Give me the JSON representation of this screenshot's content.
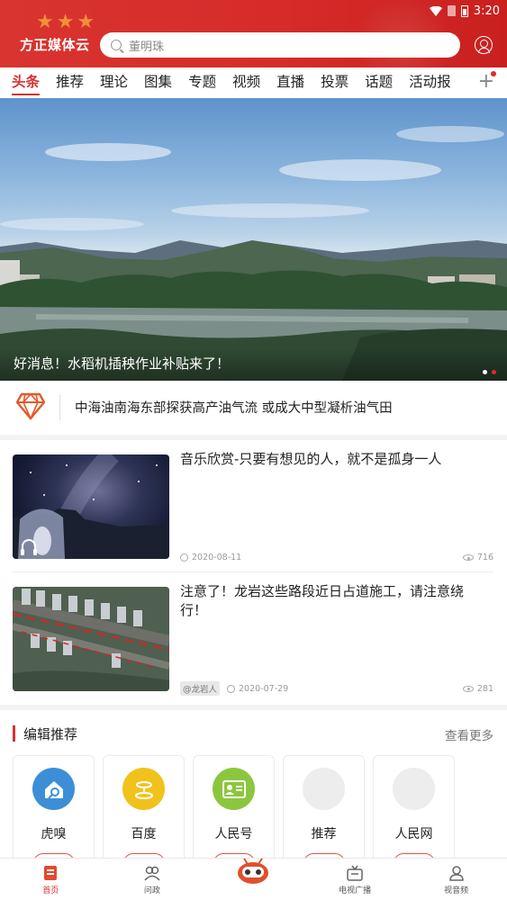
{
  "status_bar": {
    "time": "3:20"
  },
  "header": {
    "app_title": "方正媒体云",
    "search_placeholder": "董明珠",
    "accent_color": "#d63230"
  },
  "tabs": [
    {
      "label": "头条",
      "active": true
    },
    {
      "label": "推荐"
    },
    {
      "label": "理论"
    },
    {
      "label": "图集"
    },
    {
      "label": "专题"
    },
    {
      "label": "视频"
    },
    {
      "label": "直播"
    },
    {
      "label": "投票"
    },
    {
      "label": "话题"
    },
    {
      "label": "活动报"
    }
  ],
  "banner": {
    "caption": "好消息！水稻机插秧作业补贴来了！",
    "slide_count": 2,
    "active_slide": 2
  },
  "headline": {
    "text": "中海油南海东部探获高产油气流 或成大中型凝析油气田"
  },
  "news": [
    {
      "title": "音乐欣赏-只要有想见的人，就不是孤身一人",
      "date": "2020-08-11",
      "views": "716",
      "tag": "",
      "thumb": "night-sky",
      "audio": true
    },
    {
      "title": "注意了！龙岩这些路段近日占道施工，请注意绕行！",
      "date": "2020-07-29",
      "views": "281",
      "tag": "@龙岩人",
      "thumb": "aerial-city",
      "audio": false
    }
  ],
  "editor": {
    "title": "编辑推荐",
    "more": "查看更多",
    "cards": [
      {
        "name": "虎嗅",
        "icon": "huxiu-icon",
        "color": "#3c8fd6"
      },
      {
        "name": "百度",
        "icon": "baidu-icon",
        "color": "#f1c21b"
      },
      {
        "name": "人民号",
        "icon": "renminhao-icon",
        "color": "#8cc63e"
      },
      {
        "name": "推荐",
        "icon": "placeholder-icon",
        "color": "#ededed"
      },
      {
        "name": "人民网",
        "icon": "placeholder-icon",
        "color": "#ededed"
      }
    ]
  },
  "bottom_nav": [
    {
      "label": "首页",
      "icon": "home-icon",
      "active": true
    },
    {
      "label": "问政",
      "icon": "people-icon"
    },
    {
      "label": "",
      "icon": "robot-icon"
    },
    {
      "label": "电视广播",
      "icon": "tv-icon"
    },
    {
      "label": "视音频",
      "icon": "profile-icon"
    }
  ]
}
